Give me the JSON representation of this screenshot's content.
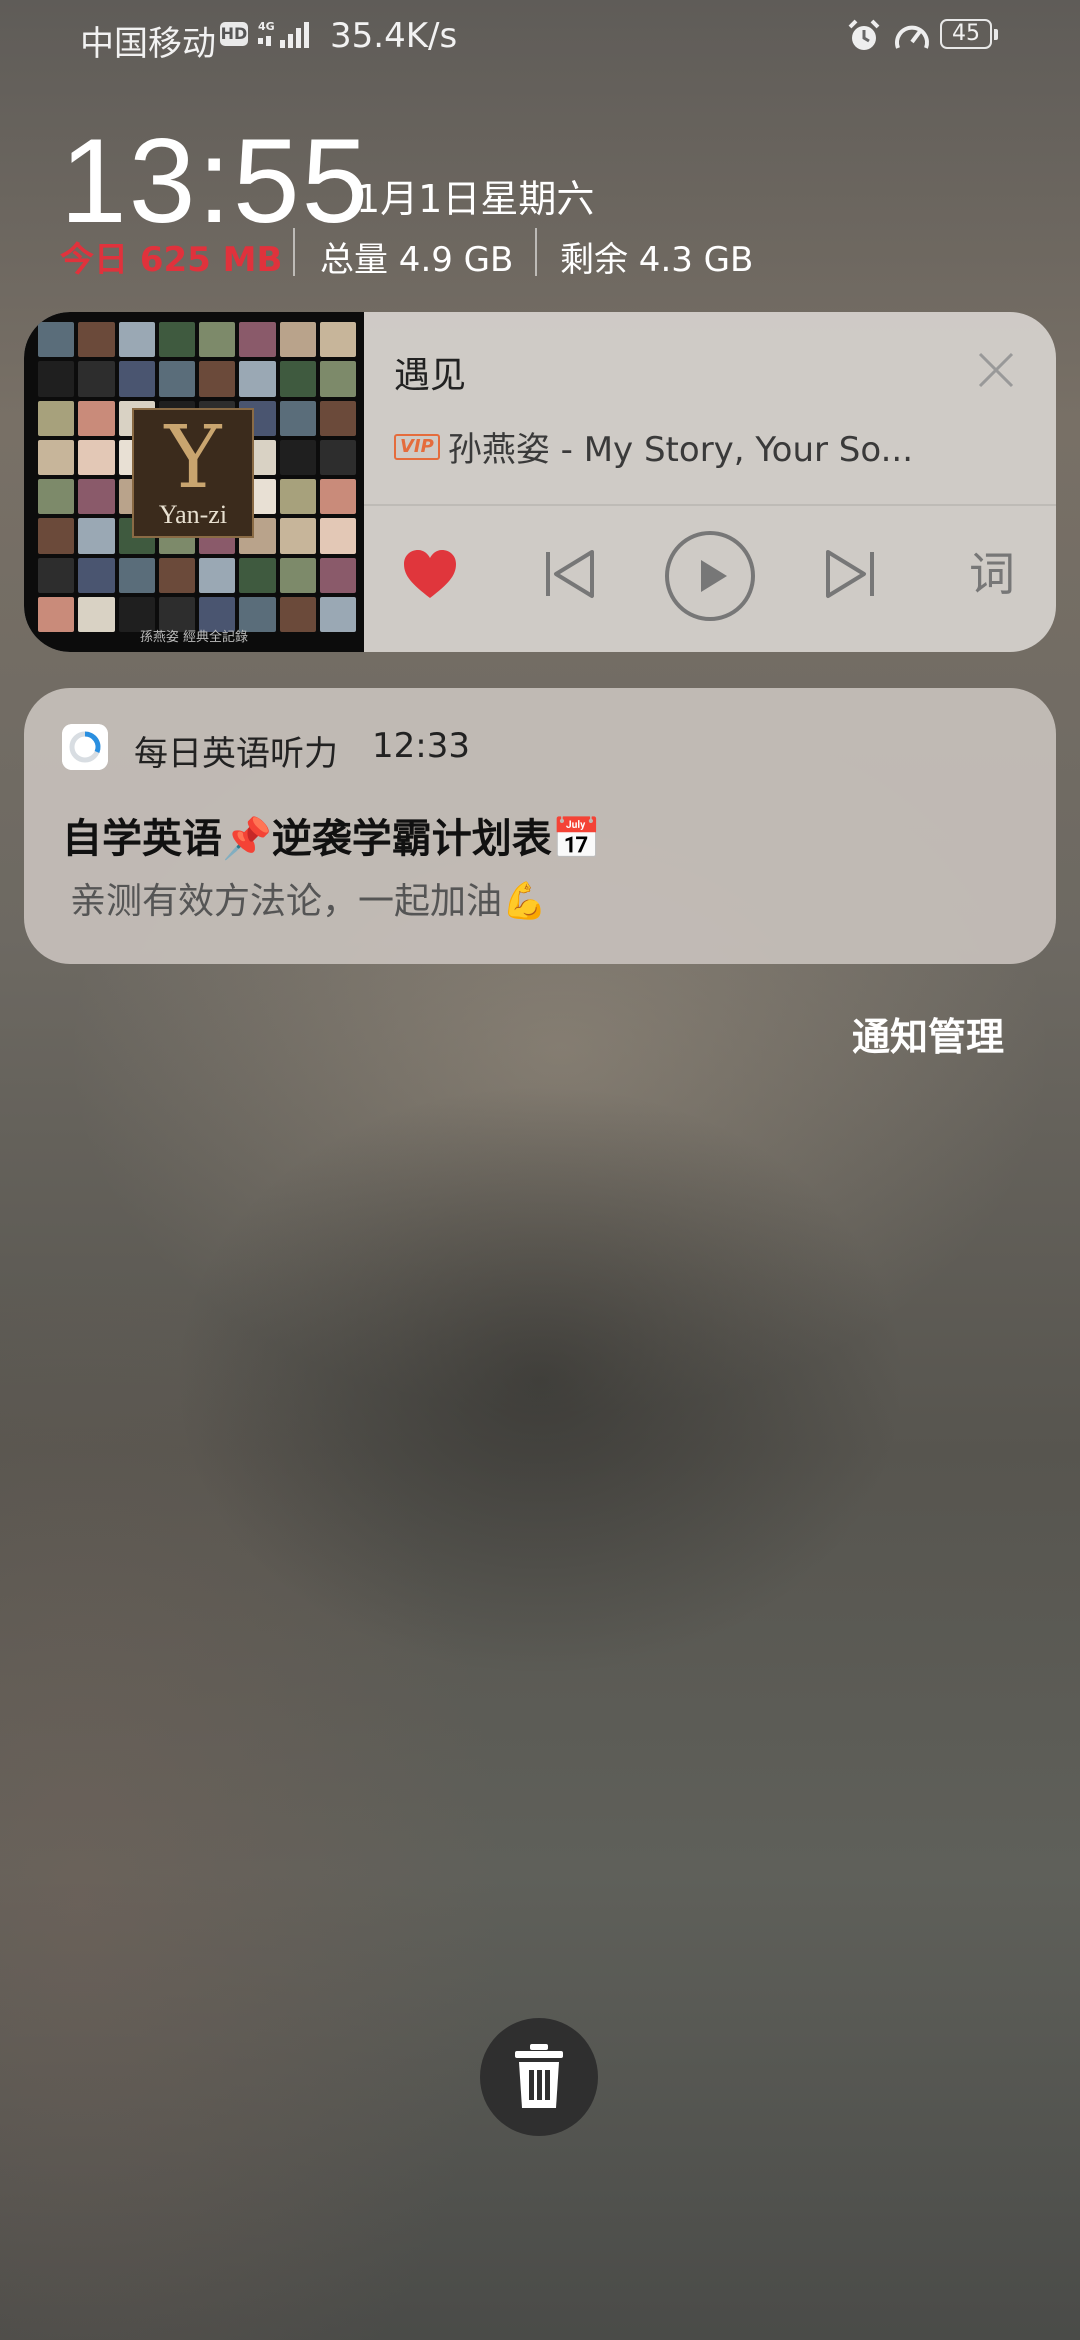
{
  "status_bar": {
    "carrier": "中国移动",
    "hd_badge": "HD",
    "network_type": "4G",
    "net_speed": "35.4K/s",
    "icons": [
      "alarm-icon",
      "gauge-icon"
    ],
    "battery_percent": "45"
  },
  "lockscreen": {
    "time": "13:55",
    "date": "1月1日星期六",
    "memory": {
      "today": "今日 625 MB",
      "total": "总量 4.9 GB",
      "free": "剩余 4.3 GB"
    }
  },
  "music_card": {
    "album_text": "Yan-zi",
    "album_caption": "孫燕姿 經典全記錄",
    "song_title": "遇见",
    "vip_badge": "VIP",
    "artist_line": "孙燕姿 - My Story, Your So...",
    "lyrics_label": "词",
    "liked": true,
    "accent_color": "#e0363c"
  },
  "notification": {
    "app_name": "每日英语听力",
    "time": "12:33",
    "title": "自学英语📌逆袭学霸计划表📅",
    "body": "亲测有效方法论，一起加油💪"
  },
  "notification_manage_label": "通知管理",
  "clear_button_icon": "trash-icon"
}
